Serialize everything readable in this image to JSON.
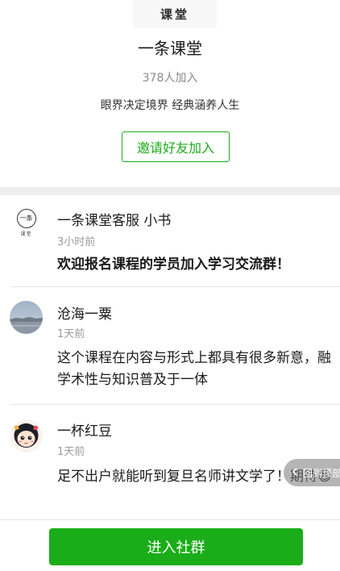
{
  "header": {
    "logo_text": "课堂",
    "group_name": "一条课堂",
    "member_count": "378人加入",
    "slogan": "眼界决定境界 经典涵养人生",
    "invite_label": "邀请好友加入"
  },
  "posts": [
    {
      "author": "一条课堂客服 小书",
      "time": "3小时前",
      "content": "欢迎报名课程的学员加入学习交流群！",
      "avatar": {
        "kind": "logo",
        "glyph": "一条",
        "subtitle": "课堂"
      }
    },
    {
      "author": "沧海一粟",
      "time": "1天前",
      "content": "这个课程在内容与形式上都具有很多新意，融学术性与知识普及于一体",
      "avatar": {
        "kind": "landscape-photo"
      }
    },
    {
      "author": "一杯红豆",
      "time": "1天前",
      "content": "足不出户就能听到复旦名师讲文学了！期待😄",
      "avatar": {
        "kind": "cartoon-girl"
      }
    }
  ],
  "toast": {
    "icon": "back-arrow-icon",
    "text": "回到顶部"
  },
  "bottom": {
    "enter_label": "进入社群"
  },
  "colors": {
    "accent": "#1aad19",
    "divider": "#ededed"
  }
}
